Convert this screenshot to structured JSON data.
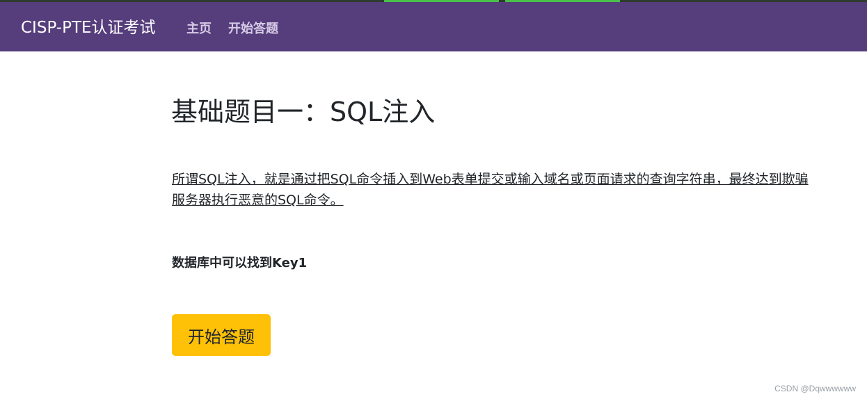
{
  "navbar": {
    "brand": "CISP-PTE认证考试",
    "links": [
      {
        "label": "主页"
      },
      {
        "label": "开始答题"
      }
    ],
    "colors": {
      "background": "#563d7c",
      "link": "#d6cbe6",
      "brand": "#ffffff"
    }
  },
  "main": {
    "title": "基础题目一：SQL注入",
    "intro": "所谓SQL注入，就是通过把SQL命令插入到Web表单提交或输入域名或页面请求的查询字符串，最终达到欺骗服务器执行恶意的SQL命令。",
    "hint": "数据库中可以找到Key1",
    "start_button": "开始答题",
    "colors": {
      "button": "#ffc107"
    }
  },
  "watermark": "CSDN @Dqwwwwww"
}
